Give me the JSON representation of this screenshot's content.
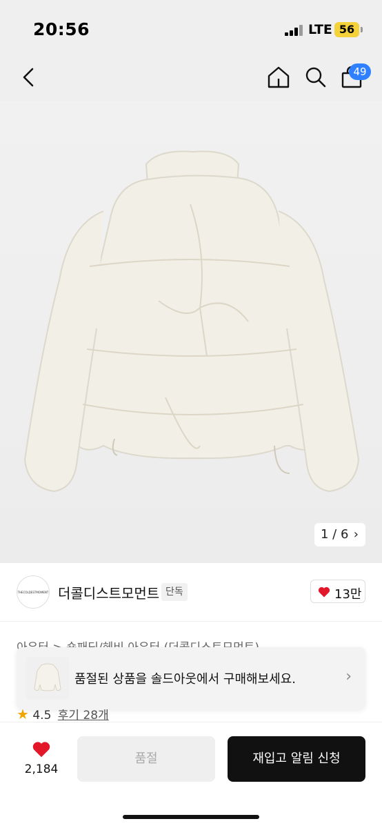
{
  "status": {
    "time": "20:56",
    "network": "LTE",
    "battery": "56"
  },
  "nav": {
    "cart_count": "49",
    "icons": [
      "back-icon",
      "home-icon",
      "search-icon",
      "bag-icon"
    ]
  },
  "gallery": {
    "current": "1",
    "total": "6",
    "separator": "/",
    "indicator": "1 / 6"
  },
  "brand": {
    "name": "더콜디스트모먼트",
    "tag": "단독",
    "logo_text": "THECOLDESTMOMENT",
    "likes": "13만"
  },
  "category": {
    "text": "아우터 > 숏패딩/헤비 아우터 (더콜디스트모먼트)"
  },
  "toast": {
    "message": "품절된 상품을 솔드아웃에서 구매해보세요."
  },
  "rating": {
    "score": "4.5",
    "reviews": "후기 28개"
  },
  "bottom": {
    "wish_count": "2,184",
    "soldout_label": "품절",
    "restock_label": "재입고 알림 신청"
  },
  "colors": {
    "accent_badge": "#2f80ff",
    "heart": "#e2172a",
    "primary_button": "#111111",
    "battery": "#f5d13a",
    "star": "#f3a600"
  }
}
